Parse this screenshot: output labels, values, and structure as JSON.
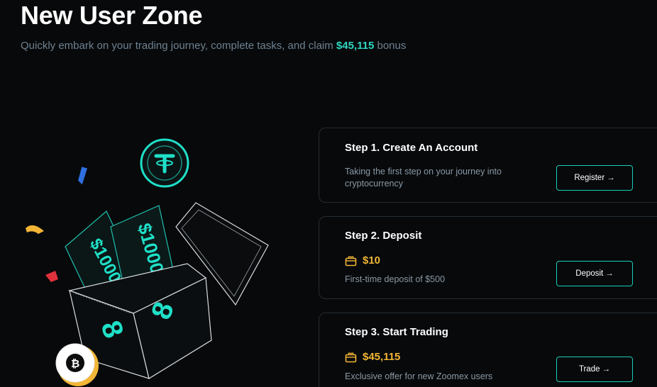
{
  "header": {
    "title": "New User Zone",
    "subtitle_prefix": "Quickly embark on your trading journey, complete tasks, and claim ",
    "subtitle_amount": "$45,115",
    "subtitle_suffix": " bonus"
  },
  "illustration": {
    "banknote_labels": [
      "$1000",
      "$1000"
    ],
    "coin_icons": [
      "tether-coin-icon",
      "bitcoin-coin-icon"
    ]
  },
  "steps": [
    {
      "title": "Step 1.  Create An Account",
      "description": "Taking the first step on your journey into cryptocurrency",
      "button_label": "Register",
      "button_arrow": "→"
    },
    {
      "title": "Step 2.  Deposit",
      "reward": "$10",
      "description": "First-time deposit of $500",
      "button_label": "Deposit",
      "button_arrow": "→"
    },
    {
      "title": "Step 3.  Start Trading",
      "reward": "$45,115",
      "description": "Exclusive offer for new Zoomex users",
      "button_label": "Trade",
      "button_arrow": "→"
    }
  ],
  "colors": {
    "background": "#07090b",
    "accent": "#19cdb7",
    "reward": "#f2b535",
    "muted_text": "#8a99a6",
    "card_border": "#262d33"
  }
}
